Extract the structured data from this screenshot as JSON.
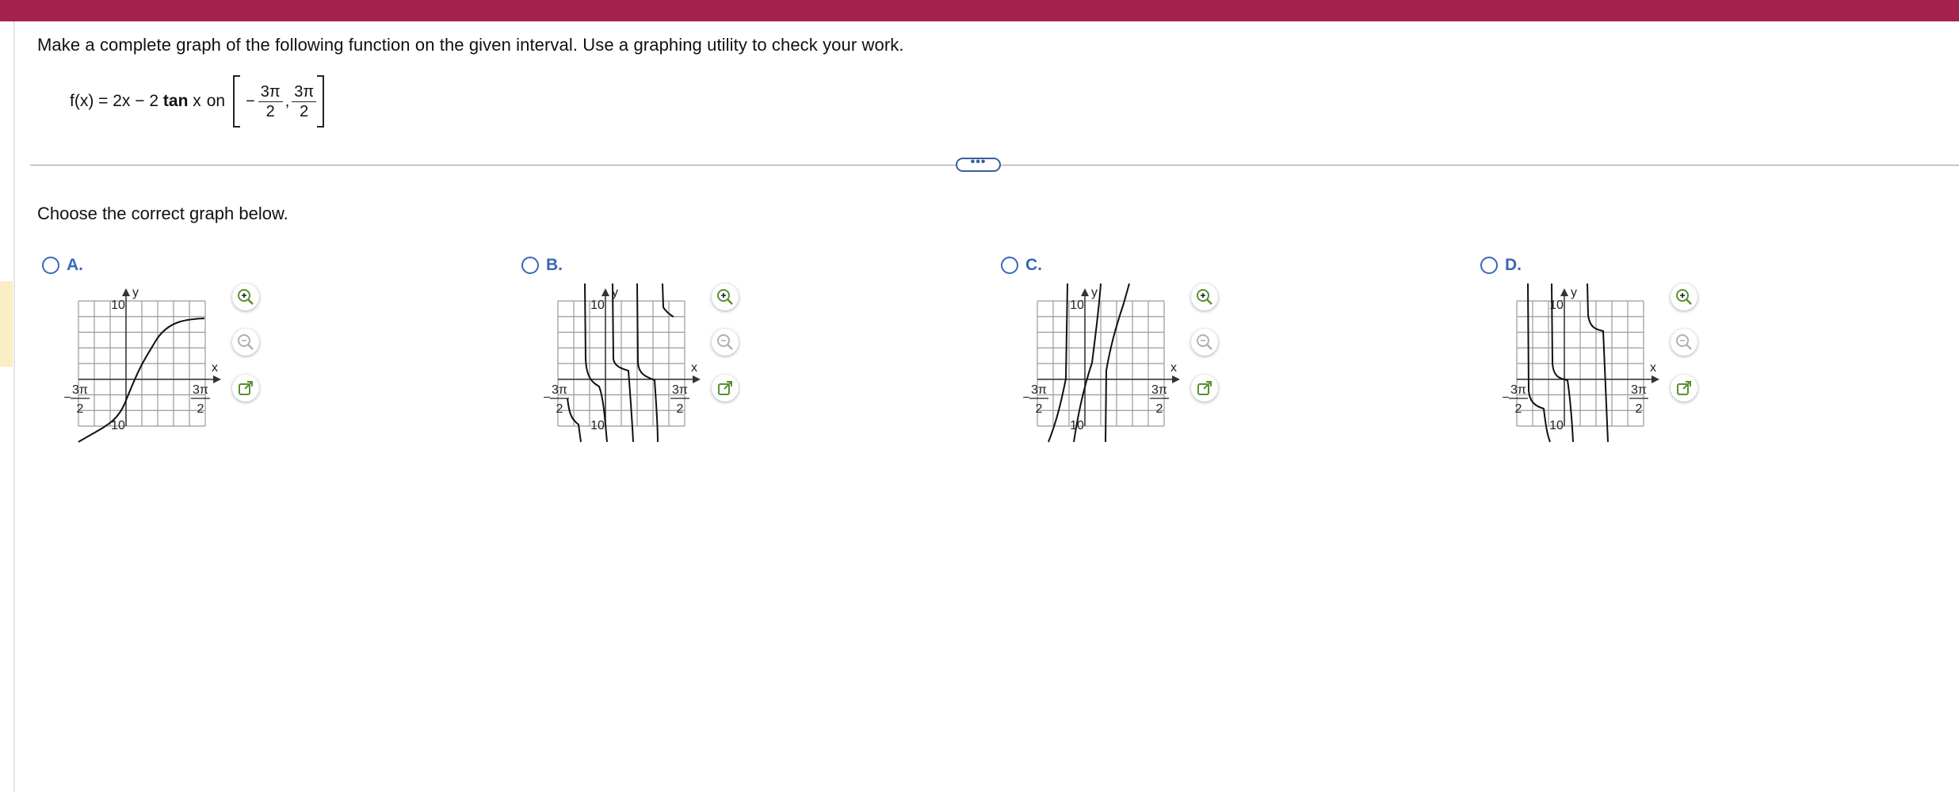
{
  "header": {
    "color": "#a3224e"
  },
  "question": {
    "instruction": "Make a complete graph of the following function on the given interval. Use a graphing utility to check your work.",
    "function_text": "f(x) = 2x − 2",
    "function_tan": "tan",
    "function_var": " x",
    "on_label": "on",
    "interval": {
      "neg": "−",
      "num": "3π",
      "den": "2",
      "comma": ","
    }
  },
  "expand_button": {
    "label": "•••"
  },
  "prompt": "Choose the correct graph below.",
  "choices": [
    {
      "letter": "A.",
      "y_top": "10",
      "y_bot": "10",
      "x_label": "x",
      "y_label": "y",
      "tick_num": "3π",
      "tick_den": "2",
      "tick_neg": "−"
    },
    {
      "letter": "B.",
      "y_top": "10",
      "y_bot": "10",
      "x_label": "x",
      "y_label": "y",
      "tick_num": "3π",
      "tick_den": "2",
      "tick_neg": "−"
    },
    {
      "letter": "C.",
      "y_top": "10",
      "y_bot": "10",
      "x_label": "x",
      "y_label": "y",
      "tick_num": "3π",
      "tick_den": "2",
      "tick_neg": "−"
    },
    {
      "letter": "D.",
      "y_top": "10",
      "y_bot": "10",
      "x_label": "x",
      "y_label": "y",
      "tick_num": "3π",
      "tick_den": "2",
      "tick_neg": "−"
    }
  ],
  "tools": {
    "zoom_in": "zoom-in-icon",
    "zoom_out": "zoom-out-icon",
    "popout": "popout-icon"
  },
  "colors": {
    "accent": "#3a66b8",
    "tool_green": "#5c8f2e"
  }
}
